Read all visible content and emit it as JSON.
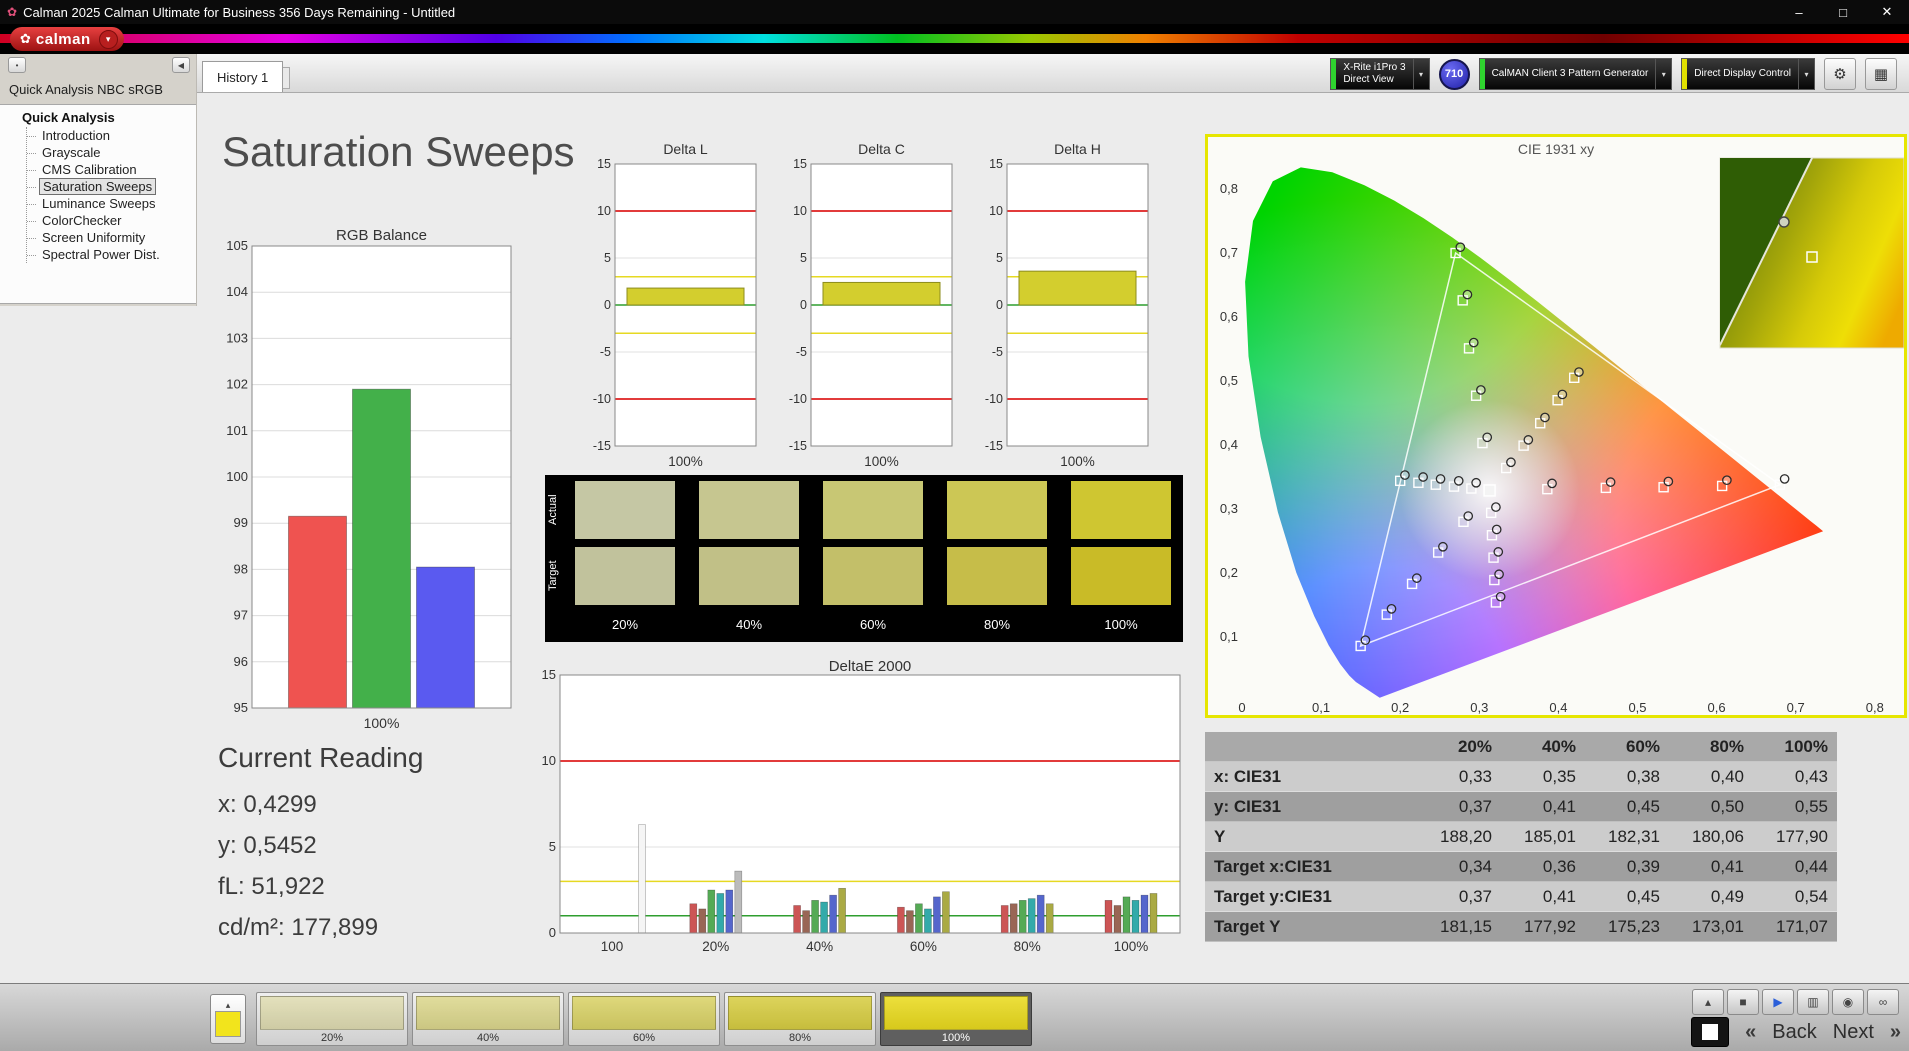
{
  "window": {
    "app_icon": "✿",
    "title": "Calman 2025 Calman Ultimate for Business 356 Days Remaining  - Untitled",
    "min_icon": "–",
    "max_icon": "□",
    "close_icon": "✕"
  },
  "logo": {
    "flower": "✿",
    "text": "calman",
    "caret": "▾"
  },
  "tabs": {
    "active": "History 1",
    "add_label": "+"
  },
  "devices": {
    "caret": "▾",
    "gear_icon": "⚙",
    "workspace_icon": "▦",
    "badge": "710",
    "items": [
      {
        "name": "meter",
        "stripe": "#2fd42f",
        "lines": [
          "X-Rite i1Pro 3",
          "Direct View"
        ]
      },
      {
        "name": "pattern-generator",
        "stripe": "#2fd42f",
        "lines": [
          "CalMAN Client 3 Pattern Generator"
        ]
      },
      {
        "name": "display-control",
        "stripe": "#e0e000",
        "lines": [
          "Direct Display Control"
        ]
      }
    ]
  },
  "sidebar": {
    "dot_icon": "•",
    "collapse_icon": "◀",
    "header": "Quick Analysis NBC sRGB",
    "root": "Quick Analysis",
    "items": [
      "Introduction",
      "Grayscale",
      "CMS Calibration",
      "Saturation Sweeps",
      "Luminance Sweeps",
      "ColorChecker",
      "Screen Uniformity",
      "Spectral Power Dist."
    ],
    "selected_index": 3
  },
  "main": {
    "title": "Saturation Sweeps"
  },
  "charts": {
    "rgb_balance": {
      "type": "bar",
      "title": "RGB Balance",
      "xlabel": "100%",
      "ylim": [
        95,
        105
      ],
      "yticks": [
        95,
        96,
        97,
        98,
        99,
        100,
        101,
        102,
        103,
        104,
        105
      ],
      "categories": [
        "Red",
        "Green",
        "Blue"
      ],
      "values": [
        99.15,
        101.9,
        98.05
      ],
      "colors": [
        "#ef5350",
        "#43b04a",
        "#5a5af0"
      ]
    },
    "delta": {
      "type": "bar",
      "ylim": [
        -15,
        15
      ],
      "yticks": [
        -15,
        -10,
        -5,
        0,
        5,
        10,
        15
      ],
      "xlabel": "100%",
      "bar_color": "#d3ce2e",
      "ref_red": [
        10,
        -10
      ],
      "ref_yellow": [
        3,
        -3
      ],
      "ref_green": [
        0
      ],
      "charts": [
        {
          "title": "Delta L",
          "value": 1.8
        },
        {
          "title": "Delta C",
          "value": 2.4
        },
        {
          "title": "Delta H",
          "value": 3.6
        }
      ]
    },
    "deltae": {
      "type": "bar",
      "title": "DeltaE 2000",
      "ylim": [
        0,
        15
      ],
      "yticks": [
        0,
        5,
        10,
        15
      ],
      "ref_red": 10,
      "ref_yellow": 3,
      "ref_green": 1,
      "groups": [
        {
          "label": "100",
          "offset": 30,
          "bars": [
            {
              "color": "#f5f5f5",
              "value": 6.3
            }
          ]
        },
        {
          "label": "20%",
          "bars": [
            {
              "color": "#cc5555",
              "value": 1.7
            },
            {
              "color": "#996655",
              "value": 1.4
            },
            {
              "color": "#55aa55",
              "value": 2.5
            },
            {
              "color": "#33aaaa",
              "value": 2.3
            },
            {
              "color": "#5566cc",
              "value": 2.5
            },
            {
              "color": "#bbbbbb",
              "value": 3.6
            }
          ]
        },
        {
          "label": "40%",
          "bars": [
            {
              "color": "#cc5555",
              "value": 1.6
            },
            {
              "color": "#996655",
              "value": 1.3
            },
            {
              "color": "#55aa55",
              "value": 1.9
            },
            {
              "color": "#33aaaa",
              "value": 1.8
            },
            {
              "color": "#5566cc",
              "value": 2.2
            },
            {
              "color": "#aaaa44",
              "value": 2.6
            }
          ]
        },
        {
          "label": "60%",
          "bars": [
            {
              "color": "#cc5555",
              "value": 1.5
            },
            {
              "color": "#996655",
              "value": 1.3
            },
            {
              "color": "#55aa55",
              "value": 1.7
            },
            {
              "color": "#33aaaa",
              "value": 1.4
            },
            {
              "color": "#5566cc",
              "value": 2.1
            },
            {
              "color": "#aaaa44",
              "value": 2.4
            }
          ]
        },
        {
          "label": "80%",
          "bars": [
            {
              "color": "#cc5555",
              "value": 1.6
            },
            {
              "color": "#996655",
              "value": 1.7
            },
            {
              "color": "#55aa55",
              "value": 1.9
            },
            {
              "color": "#33aaaa",
              "value": 2.0
            },
            {
              "color": "#5566cc",
              "value": 2.2
            },
            {
              "color": "#aaaa44",
              "value": 1.7
            }
          ]
        },
        {
          "label": "100%",
          "bars": [
            {
              "color": "#cc5555",
              "value": 1.9
            },
            {
              "color": "#996655",
              "value": 1.6
            },
            {
              "color": "#55aa55",
              "value": 2.1
            },
            {
              "color": "#33aaaa",
              "value": 1.9
            },
            {
              "color": "#5566cc",
              "value": 2.2
            },
            {
              "color": "#aaaa44",
              "value": 2.3
            }
          ]
        }
      ]
    },
    "cie": {
      "title": "CIE 1931 xy",
      "xticks": [
        "0",
        "0,1",
        "0,2",
        "0,3",
        "0,4",
        "0,5",
        "0,6",
        "0,7",
        "0,8"
      ],
      "yticks": [
        "0,1",
        "0,2",
        "0,3",
        "0,4",
        "0,5",
        "0,6",
        "0,7",
        "0,8"
      ],
      "triangle": [
        [
          0.27,
          0.7
        ],
        [
          0.68,
          0.338
        ],
        [
          0.15,
          0.086
        ]
      ],
      "white_point": [
        0.313,
        0.329
      ],
      "target_squares": [
        [
          0.386,
          0.331
        ],
        [
          0.46,
          0.333
        ],
        [
          0.533,
          0.334
        ],
        [
          0.607,
          0.336
        ],
        [
          0.68,
          0.338
        ],
        [
          0.29,
          0.332
        ],
        [
          0.268,
          0.335
        ],
        [
          0.245,
          0.338
        ],
        [
          0.223,
          0.341
        ],
        [
          0.2,
          0.344
        ],
        [
          0.304,
          0.403
        ],
        [
          0.296,
          0.477
        ],
        [
          0.287,
          0.551
        ],
        [
          0.279,
          0.626
        ],
        [
          0.27,
          0.7
        ],
        [
          0.28,
          0.28
        ],
        [
          0.248,
          0.232
        ],
        [
          0.215,
          0.183
        ],
        [
          0.183,
          0.135
        ],
        [
          0.15,
          0.086
        ],
        [
          0.315,
          0.294
        ],
        [
          0.316,
          0.259
        ],
        [
          0.318,
          0.224
        ],
        [
          0.319,
          0.189
        ],
        [
          0.321,
          0.154
        ],
        [
          0.334,
          0.364
        ],
        [
          0.356,
          0.399
        ],
        [
          0.377,
          0.434
        ],
        [
          0.399,
          0.47
        ],
        [
          0.42,
          0.505
        ]
      ],
      "measured_circles": [
        [
          0.392,
          0.34
        ],
        [
          0.466,
          0.342
        ],
        [
          0.539,
          0.343
        ],
        [
          0.613,
          0.345
        ],
        [
          0.686,
          0.347
        ],
        [
          0.296,
          0.341
        ],
        [
          0.274,
          0.344
        ],
        [
          0.251,
          0.347
        ],
        [
          0.229,
          0.35
        ],
        [
          0.206,
          0.353
        ],
        [
          0.31,
          0.412
        ],
        [
          0.302,
          0.486
        ],
        [
          0.293,
          0.56
        ],
        [
          0.285,
          0.635
        ],
        [
          0.276,
          0.709
        ],
        [
          0.286,
          0.289
        ],
        [
          0.254,
          0.241
        ],
        [
          0.221,
          0.192
        ],
        [
          0.189,
          0.144
        ],
        [
          0.156,
          0.095
        ],
        [
          0.321,
          0.303
        ],
        [
          0.322,
          0.268
        ],
        [
          0.324,
          0.233
        ],
        [
          0.325,
          0.198
        ],
        [
          0.327,
          0.163
        ],
        [
          0.34,
          0.373
        ],
        [
          0.362,
          0.408
        ],
        [
          0.383,
          0.443
        ],
        [
          0.405,
          0.479
        ],
        [
          0.426,
          0.514
        ]
      ]
    }
  },
  "swatch_panel": {
    "row_labels": [
      "Actual",
      "Target"
    ],
    "col_labels": [
      "20%",
      "40%",
      "60%",
      "80%",
      "100%"
    ],
    "actual": [
      "#c5c7a4",
      "#c6c690",
      "#c8c774",
      "#ccc755",
      "#cfc631"
    ],
    "target": [
      "#c1c29c",
      "#c1c087",
      "#c3bf69",
      "#c6bd49",
      "#c9bb27"
    ]
  },
  "table": {
    "columns": [
      "20%",
      "40%",
      "60%",
      "80%",
      "100%"
    ],
    "rows": [
      {
        "label": "x: CIE31",
        "values": [
          "0,33",
          "0,35",
          "0,38",
          "0,40",
          "0,43"
        ]
      },
      {
        "label": "y: CIE31",
        "values": [
          "0,37",
          "0,41",
          "0,45",
          "0,50",
          "0,55"
        ]
      },
      {
        "label": "Y",
        "values": [
          "188,20",
          "185,01",
          "182,31",
          "180,06",
          "177,90"
        ]
      },
      {
        "label": "Target x:CIE31",
        "values": [
          "0,34",
          "0,36",
          "0,39",
          "0,41",
          "0,44"
        ]
      },
      {
        "label": "Target y:CIE31",
        "values": [
          "0,37",
          "0,41",
          "0,45",
          "0,49",
          "0,54"
        ]
      },
      {
        "label": "Target Y",
        "values": [
          "181,15",
          "177,92",
          "175,23",
          "173,01",
          "171,07"
        ]
      }
    ]
  },
  "current_reading": {
    "title": "Current Reading",
    "lines": [
      "x: 0,4299",
      "y: 0,5452",
      "fL: 51,922",
      "cd/m²: 177,899"
    ]
  },
  "bottom": {
    "mini_up_icon": "▴",
    "mini_color": "#f2e41c",
    "swatches": [
      {
        "label": "20%",
        "color": "#dfdcb2",
        "selected": false
      },
      {
        "label": "40%",
        "color": "#dcd78d",
        "selected": false
      },
      {
        "label": "60%",
        "color": "#d9d267",
        "selected": false
      },
      {
        "label": "80%",
        "color": "#d7cd42",
        "selected": false
      },
      {
        "label": "100%",
        "color": "#e9da1e",
        "selected": true
      }
    ],
    "tools": [
      {
        "name": "up",
        "icon": "▴",
        "color": "#444444"
      },
      {
        "name": "stop",
        "icon": "■",
        "color": "#444444"
      },
      {
        "name": "play",
        "icon": "▶",
        "color": "#2b5fd9"
      },
      {
        "name": "save",
        "icon": "▥",
        "color": "#444444"
      },
      {
        "name": "preview",
        "icon": "◉",
        "color": "#444444"
      },
      {
        "name": "loop",
        "icon": "∞",
        "color": "#444444"
      }
    ],
    "back_chevron": "«",
    "back": "Back",
    "next": "Next",
    "next_chevron": "»"
  }
}
